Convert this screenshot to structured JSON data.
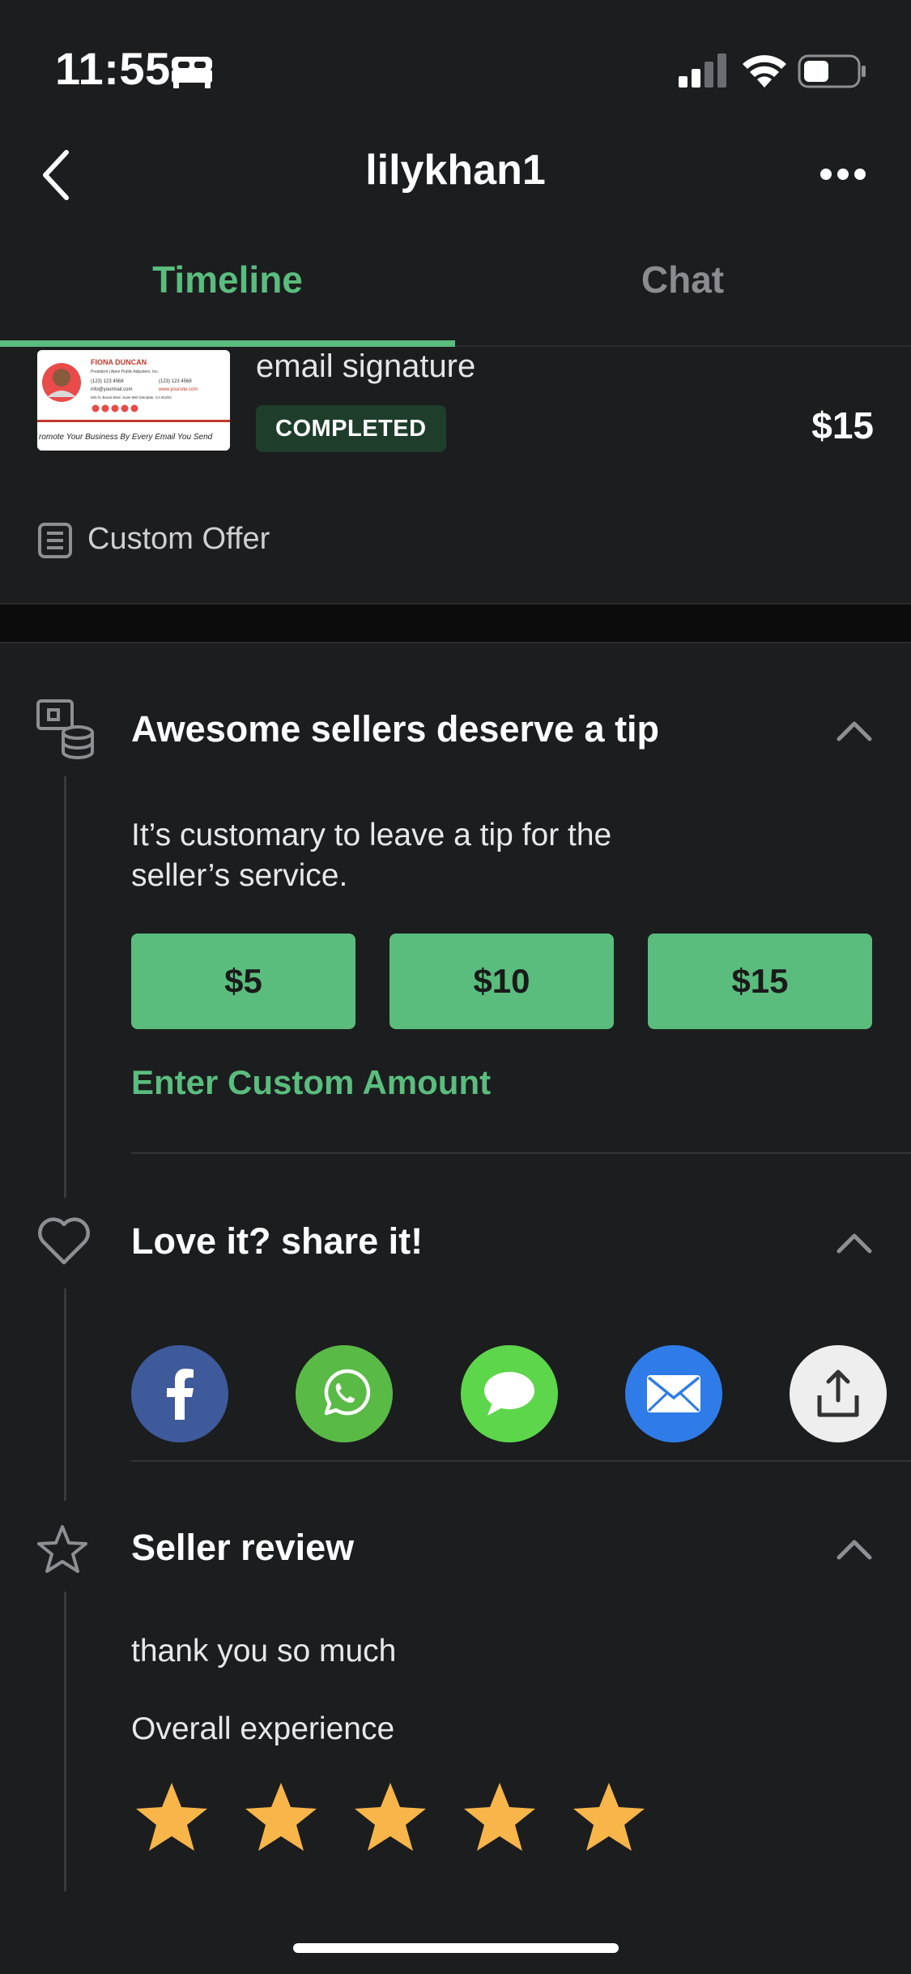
{
  "status": {
    "time": "11:55"
  },
  "nav": {
    "title": "lilykhan1"
  },
  "tabs": [
    {
      "label": "Timeline",
      "active": true
    },
    {
      "label": "Chat",
      "active": false
    }
  ],
  "order": {
    "title": "email signature",
    "status": "COMPLETED",
    "price": "$15",
    "thumbnail": {
      "name": "FIONA DUNCAN",
      "role": "President | Apex Public Adjusters, Inc.",
      "phone1": "(123) 123 4568",
      "phone2": "(123) 123 4568",
      "email": "info@yourmail.com",
      "web": "www.yoursite.com",
      "address": "500 N. Brand Blvd. Suite 990 Glendale, CA 91203",
      "banner": "romote Your Business By  Every Email You Send"
    }
  },
  "offer": {
    "label": "Custom Offer",
    "icon": "receipt-icon"
  },
  "tip": {
    "title": "Awesome sellers deserve a tip",
    "description": "It’s customary to leave a tip for the seller’s service.",
    "amounts": [
      "$5",
      "$10",
      "$15"
    ],
    "custom_label": "Enter Custom Amount",
    "icon": "tip-coins-icon"
  },
  "share": {
    "title": "Love it? share it!",
    "icon": "heart-icon",
    "targets": [
      {
        "name": "facebook",
        "color": "#3e5a9b"
      },
      {
        "name": "whatsapp",
        "color": "#5aba46"
      },
      {
        "name": "messages",
        "color": "#5dd64b"
      },
      {
        "name": "mail",
        "color": "#2f7ce8"
      },
      {
        "name": "share-sheet",
        "color": "#eeeeee"
      }
    ]
  },
  "review": {
    "title": "Seller review",
    "icon": "star-outline-icon",
    "text": "thank you so much",
    "overall_label": "Overall experience",
    "rating": 5,
    "max_rating": 5
  },
  "colors": {
    "accent": "#5abd7e",
    "background": "#1c1d1f",
    "star": "#f7b54a"
  }
}
